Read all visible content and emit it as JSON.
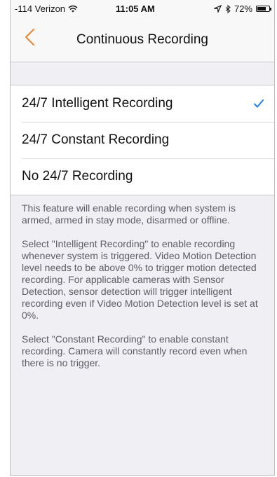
{
  "status_bar": {
    "carrier": "-114 Verizon",
    "time": "11:05 AM",
    "battery_percent": "72%",
    "battery_level": 0.72,
    "icons": [
      "wifi-icon",
      "location-arrow-icon",
      "bluetooth-icon",
      "battery-icon"
    ]
  },
  "nav": {
    "title": "Continuous Recording",
    "back_icon": "chevron-left-icon"
  },
  "colors": {
    "accent_back": "#e8893a",
    "checkmark": "#1f7fdc",
    "background": "#efeff4"
  },
  "options": [
    {
      "label": "24/7 Intelligent Recording",
      "selected": true
    },
    {
      "label": "24/7 Constant Recording",
      "selected": false
    },
    {
      "label": "No 24/7 Recording",
      "selected": false
    }
  ],
  "description": {
    "p1": "This feature will enable recording when system is armed, armed in stay mode, disarmed or offline.",
    "p2": "Select \"Intelligent Recording\" to enable recording whenever system is triggered. Video Motion Detection level needs to be above 0% to trigger motion detected recording. For applicable cameras with Sensor Detection, sensor detection will trigger intelligent recording even if Video Motion Detection level is set at 0%.",
    "p3": "Select \"Constant Recording\" to enable constant recording. Camera will constantly record even when there is no trigger."
  }
}
